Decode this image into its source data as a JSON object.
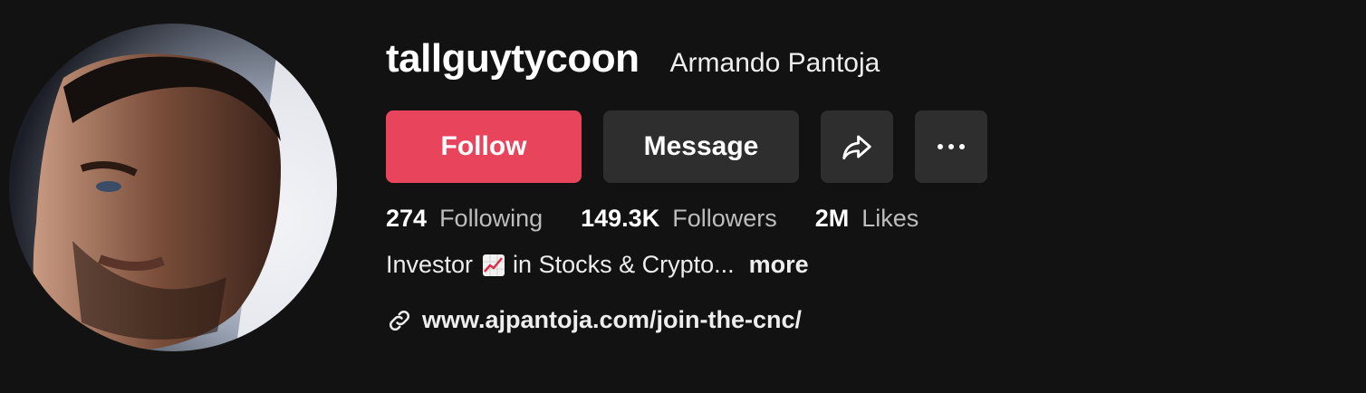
{
  "profile": {
    "username": "tallguytycoon",
    "display_name": "Armando Pantoja",
    "avatar": "profile-photo"
  },
  "actions": {
    "follow_label": "Follow",
    "message_label": "Message",
    "share_icon": "share-arrow-icon",
    "more_icon": "more-dots-icon"
  },
  "stats": {
    "following_count": "274",
    "following_label": "Following",
    "followers_count": "149.3K",
    "followers_label": "Followers",
    "likes_count": "2M",
    "likes_label": "Likes"
  },
  "bio": {
    "text_before": "Investor",
    "emoji": "chart-increasing",
    "text_after": "in Stocks & Crypto...",
    "more_label": "more"
  },
  "link": {
    "icon": "link-icon",
    "url": "www.ajpantoja.com/join-the-cnc/"
  },
  "colors": {
    "background": "#121212",
    "follow_button": "#e8445c",
    "secondary_button": "#2e2e2e"
  }
}
